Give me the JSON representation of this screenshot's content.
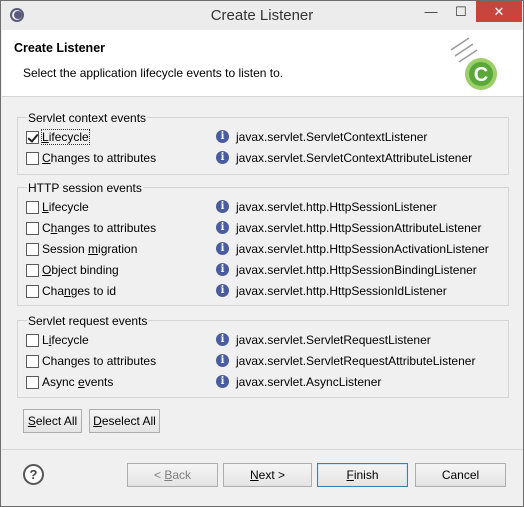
{
  "window": {
    "title": "Create Listener",
    "minimize": "—",
    "maximize": "☐",
    "close": "✕"
  },
  "banner": {
    "heading": "Create Listener",
    "description": "Select the application lifecycle events to listen to."
  },
  "groups": [
    {
      "title": "Servlet context events",
      "items": [
        {
          "label": "Lifecycle",
          "checked": true,
          "interface": "javax.servlet.ServletContextListener"
        },
        {
          "label": "Changes to attributes",
          "checked": false,
          "interface": "javax.servlet.ServletContextAttributeListener"
        }
      ]
    },
    {
      "title": "HTTP session events",
      "items": [
        {
          "label": "Lifecycle",
          "checked": false,
          "interface": "javax.servlet.http.HttpSessionListener"
        },
        {
          "label": "Changes to attributes",
          "checked": false,
          "interface": "javax.servlet.http.HttpSessionAttributeListener"
        },
        {
          "label": "Session migration",
          "checked": false,
          "interface": "javax.servlet.http.HttpSessionActivationListener"
        },
        {
          "label": "Object binding",
          "checked": false,
          "interface": "javax.servlet.http.HttpSessionBindingListener"
        },
        {
          "label": "Changes to id",
          "checked": false,
          "interface": "javax.servlet.http.HttpSessionIdListener"
        }
      ]
    },
    {
      "title": "Servlet request events",
      "items": [
        {
          "label": "Lifecycle",
          "checked": false,
          "interface": "javax.servlet.ServletRequestListener"
        },
        {
          "label": "Changes to attributes",
          "checked": false,
          "interface": "javax.servlet.ServletRequestAttributeListener"
        },
        {
          "label": "Async events",
          "checked": false,
          "interface": "javax.servlet.AsyncListener"
        }
      ]
    }
  ],
  "selection_buttons": {
    "select_all": "Select All",
    "deselect_all": "Deselect All"
  },
  "footer": {
    "help": "?",
    "back": "< Back",
    "next": "Next >",
    "finish": "Finish",
    "cancel": "Cancel"
  },
  "icons": {
    "info": "i"
  }
}
